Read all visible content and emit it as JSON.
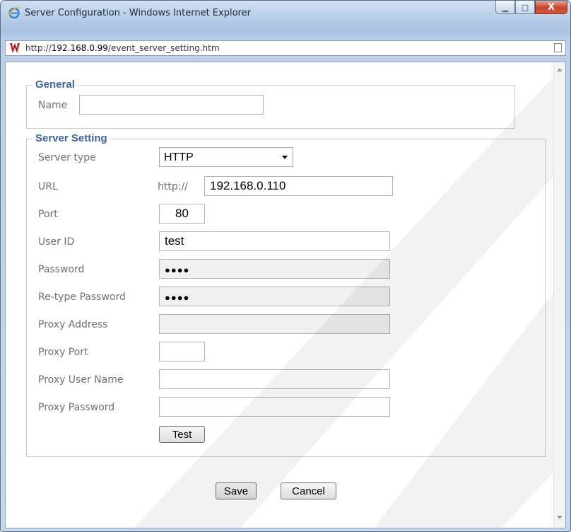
{
  "window": {
    "title": "Server Configuration - Windows Internet Explorer",
    "minimize_glyph": "▁",
    "maximize_glyph": "□",
    "close_glyph": "X"
  },
  "address": {
    "prefix": "http://",
    "host": "192.168.0.99",
    "path": "/event_server_setting.htm"
  },
  "general": {
    "legend": "General",
    "name_label": "Name",
    "name_value": ""
  },
  "server": {
    "legend": "Server Setting",
    "server_type_label": "Server type",
    "server_type_value": "HTTP",
    "url_label": "URL",
    "url_prefix": "http://",
    "url_value": "192.168.0.110",
    "port_label": "Port",
    "port_value": "80",
    "user_id_label": "User ID",
    "user_id_value": "test",
    "password_label": "Password",
    "password_value": "●●●●",
    "retype_label": "Re-type Password",
    "retype_value": "●●●●",
    "proxy_address_label": "Proxy Address",
    "proxy_address_value": "",
    "proxy_port_label": "Proxy Port",
    "proxy_port_value": "",
    "proxy_user_label": "Proxy User Name",
    "proxy_user_value": "",
    "proxy_password_label": "Proxy Password",
    "proxy_password_value": "",
    "test_button": "Test"
  },
  "actions": {
    "save": "Save",
    "cancel": "Cancel"
  },
  "colors": {
    "legend": "#3c63a3",
    "label": "#707070",
    "close_button": "#c8432c"
  }
}
